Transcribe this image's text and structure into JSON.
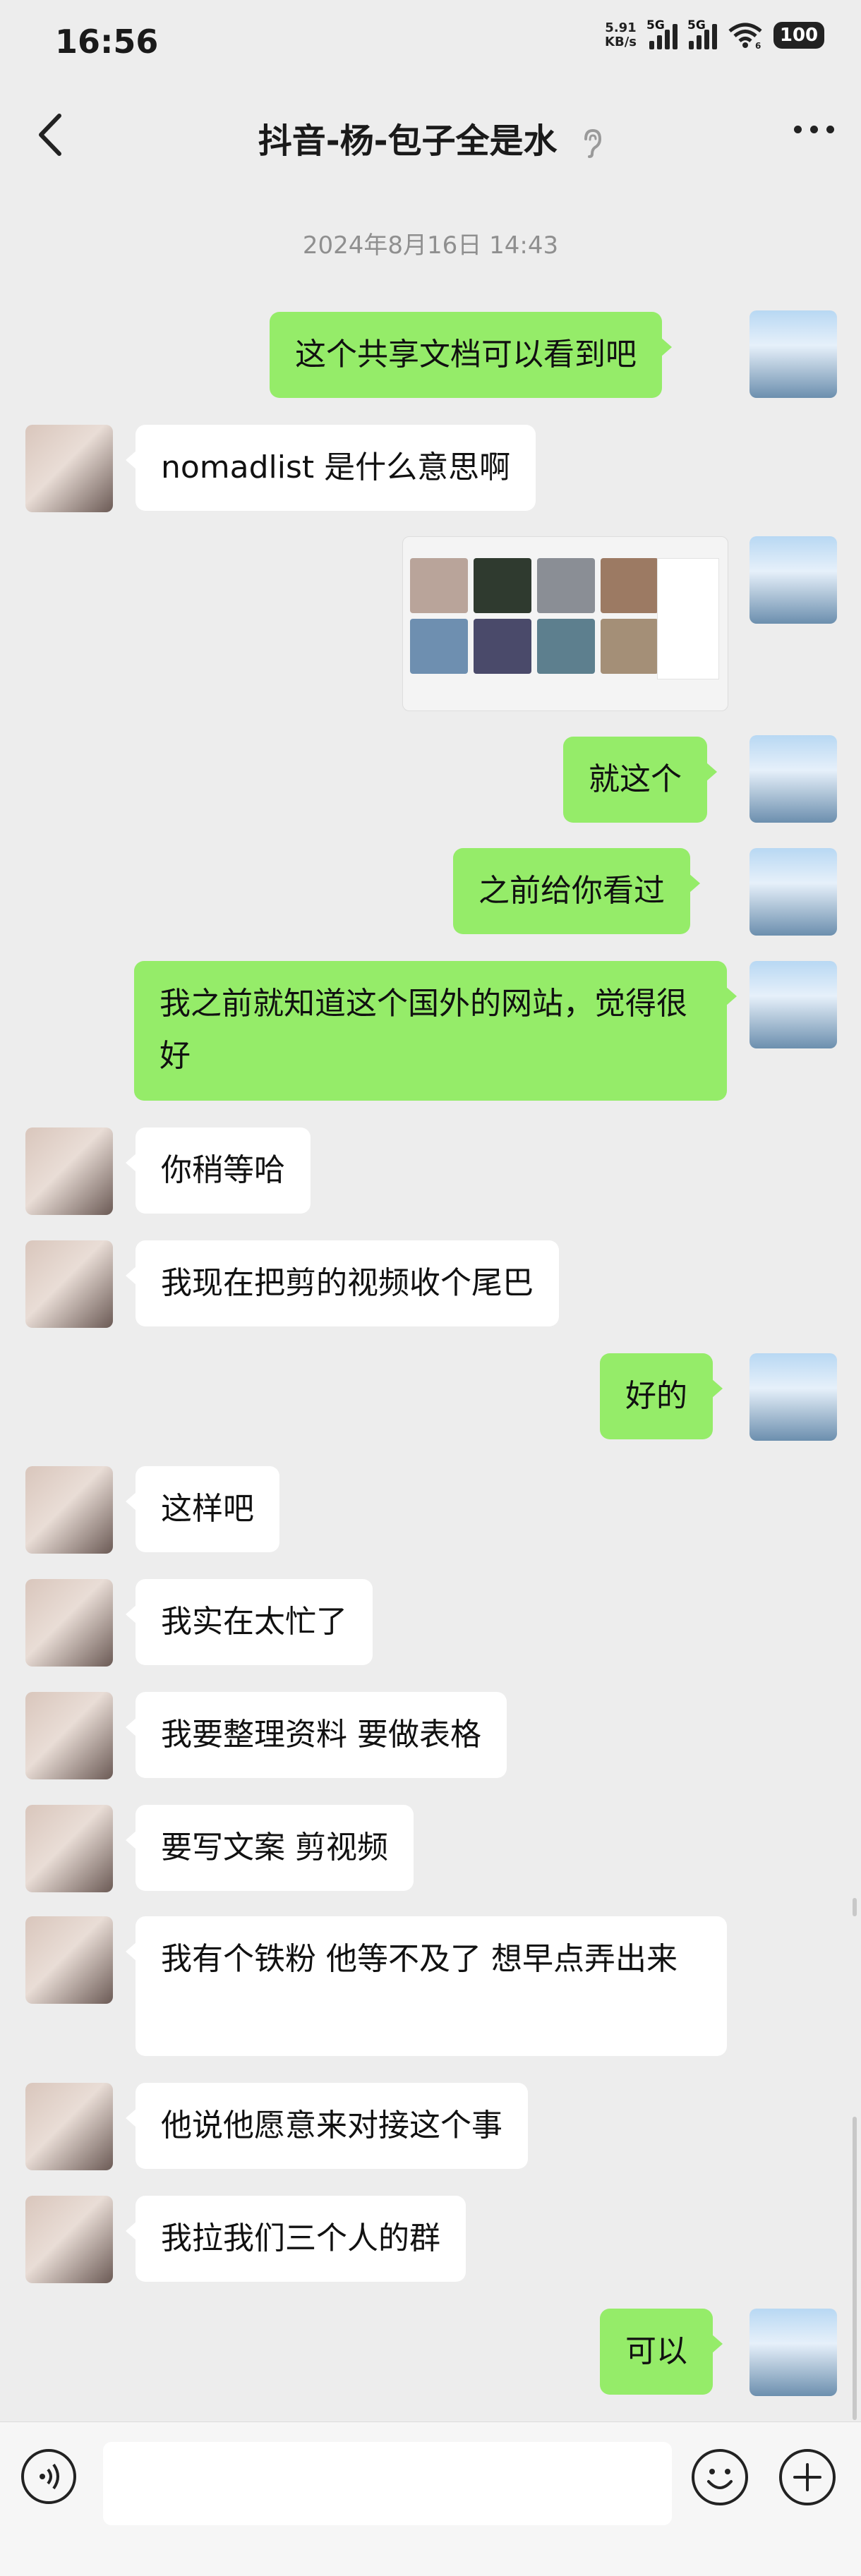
{
  "status_bar": {
    "time": "16:56",
    "speed_value": "5.91",
    "speed_unit": "KB/s",
    "signal1_label": "5G",
    "signal2_label": "5G",
    "wifi_badge": "6",
    "battery": "100"
  },
  "header": {
    "title": "抖音-杨-包子全是水"
  },
  "timestamp": "2024年8月16日 14:43",
  "messages": [
    {
      "from": "me",
      "text": "这个共享文档可以看到吧"
    },
    {
      "from": "other",
      "text": "nomadlist 是什么意思啊"
    },
    {
      "from": "me",
      "type": "image"
    },
    {
      "from": "me",
      "text": "就这个"
    },
    {
      "from": "me",
      "text": "之前给你看过"
    },
    {
      "from": "me",
      "text": "我之前就知道这个国外的网站，觉得很好"
    },
    {
      "from": "other",
      "text": "你稍等哈"
    },
    {
      "from": "other",
      "text": "我现在把剪的视频收个尾巴"
    },
    {
      "from": "me",
      "text": "好的"
    },
    {
      "from": "other",
      "text": "这样吧"
    },
    {
      "from": "other",
      "text": "我实在太忙了"
    },
    {
      "from": "other",
      "text": "我要整理资料 要做表格"
    },
    {
      "from": "other",
      "text": "要写文案 剪视频"
    },
    {
      "from": "other",
      "text": "我有个铁粉 他等不及了 想早点弄出来"
    },
    {
      "from": "other",
      "text": "他说他愿意来对接这个事"
    },
    {
      "from": "other",
      "text": "我拉我们三个人的群"
    },
    {
      "from": "me",
      "text": "可以"
    }
  ],
  "colors": {
    "background": "#ededed",
    "my_bubble": "#95ec69",
    "other_bubble": "#ffffff",
    "timestamp": "#8f8f8f"
  }
}
